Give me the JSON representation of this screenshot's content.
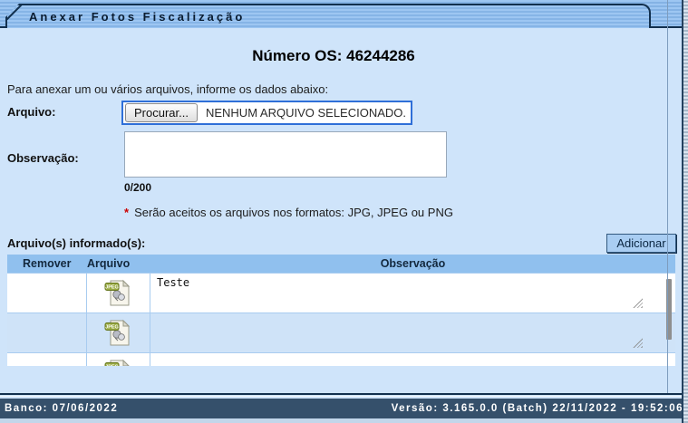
{
  "window": {
    "title": "Anexar Fotos Fiscalização"
  },
  "header": {
    "os_number_label": "Número OS: 46244286"
  },
  "form": {
    "intro": "Para anexar um ou vários arquivos, informe os dados abaixo:",
    "file_label": "Arquivo:",
    "browse_button_label": "Procurar...",
    "no_file_selected_text": "NENHUM ARQUIVO SELECIONADO.",
    "observation_label": "Observação:",
    "observation_value": "",
    "char_counter": "0/200",
    "note_asterisk": "*",
    "note_text": "Serão aceitos os arquivos nos formatos: JPG, JPEG ou PNG"
  },
  "files_section": {
    "label": "Arquivo(s) informado(s):",
    "add_button_label": "Adicionar",
    "file_icon_label": "JPEG",
    "table": {
      "headers": [
        "Remover",
        "Arquivo",
        "Observação"
      ],
      "rows": [
        {
          "file_icon": "jpeg-file-icon",
          "observation": "Teste"
        },
        {
          "file_icon": "jpeg-file-icon",
          "observation": ""
        },
        {
          "file_icon": "jpeg-file-icon",
          "observation": ""
        }
      ]
    }
  },
  "status_bar": {
    "left_text": "Banco: 07/06/2022",
    "right_text": "Versão: 3.165.0.0 (Batch) 22/11/2022 - 19:52:06"
  },
  "colors": {
    "accent_border": "#2f6fd8",
    "band_stripe_dark": "#84b2e4",
    "band_stripe_light": "#9dc6f2",
    "table_header_bg": "#90c0ee",
    "row_alt_bg": "#cfe3f8",
    "status_bar_bg": "#35506b",
    "note_asterisk_color": "#cc0000",
    "background": "#cfe4fa"
  }
}
